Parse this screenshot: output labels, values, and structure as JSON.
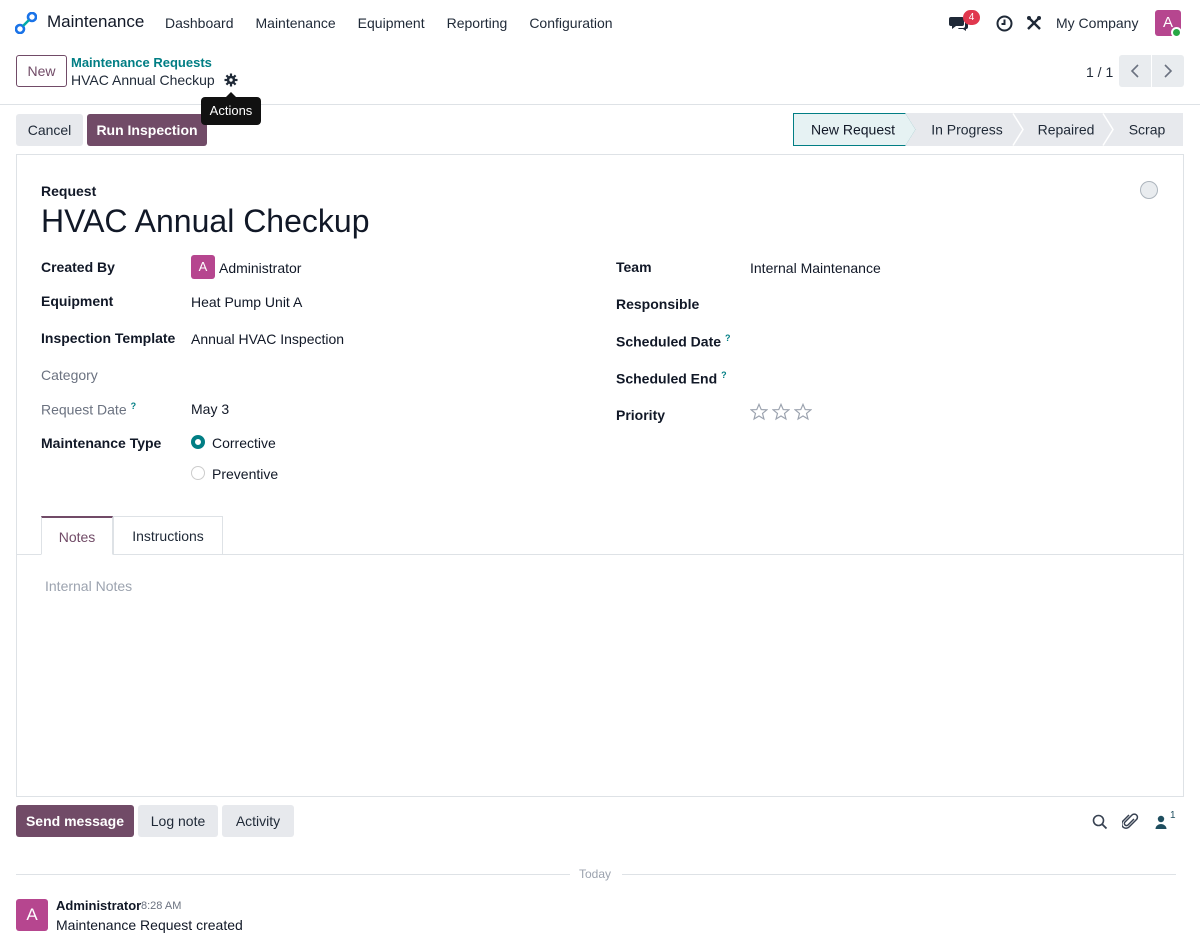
{
  "app": {
    "name": "Maintenance",
    "brand_color": "#714b67",
    "accent_color": "#017e84"
  },
  "menu": [
    "Dashboard",
    "Maintenance",
    "Equipment",
    "Reporting",
    "Configuration"
  ],
  "systray": {
    "messages_count": "4",
    "company": "My Company",
    "user_initial": "A"
  },
  "breadcrumb": {
    "parent": "Maintenance Requests",
    "current": "HVAC Annual Checkup",
    "tooltip": "Actions"
  },
  "control": {
    "new_label": "New",
    "pager": "1 / 1"
  },
  "actions": {
    "cancel": "Cancel",
    "run_inspection": "Run Inspection"
  },
  "stages": {
    "items": [
      "New Request",
      "In Progress",
      "Repaired",
      "Scrap"
    ],
    "active": "New Request"
  },
  "form": {
    "section_label": "Request",
    "title": "HVAC Annual Checkup",
    "left": {
      "created_by_label": "Created By",
      "created_by_value": "Administrator",
      "created_by_initial": "A",
      "equipment_label": "Equipment",
      "equipment_value": "Heat Pump Unit A",
      "template_label": "Inspection Template",
      "template_value": "Annual HVAC Inspection",
      "category_label": "Category",
      "request_date_label": "Request Date",
      "request_date_value": "May 3",
      "maintenance_type_label": "Maintenance Type",
      "type_options": [
        "Corrective",
        "Preventive"
      ],
      "type_selected": "Corrective"
    },
    "right": {
      "team_label": "Team",
      "team_value": "Internal Maintenance",
      "responsible_label": "Responsible",
      "scheduled_date_label": "Scheduled Date",
      "scheduled_end_label": "Scheduled End",
      "priority_label": "Priority",
      "priority_stars": 0,
      "priority_max": 3
    },
    "help_mark": "?",
    "tabs": [
      "Notes",
      "Instructions"
    ],
    "notes_placeholder": "Internal Notes"
  },
  "chatter": {
    "send_message": "Send message",
    "log_note": "Log note",
    "activity": "Activity",
    "followers_count": "1",
    "date_divider": "Today",
    "message": {
      "author": "Administrator",
      "time": "8:28 AM",
      "body": "Maintenance Request created",
      "initial": "A"
    }
  }
}
